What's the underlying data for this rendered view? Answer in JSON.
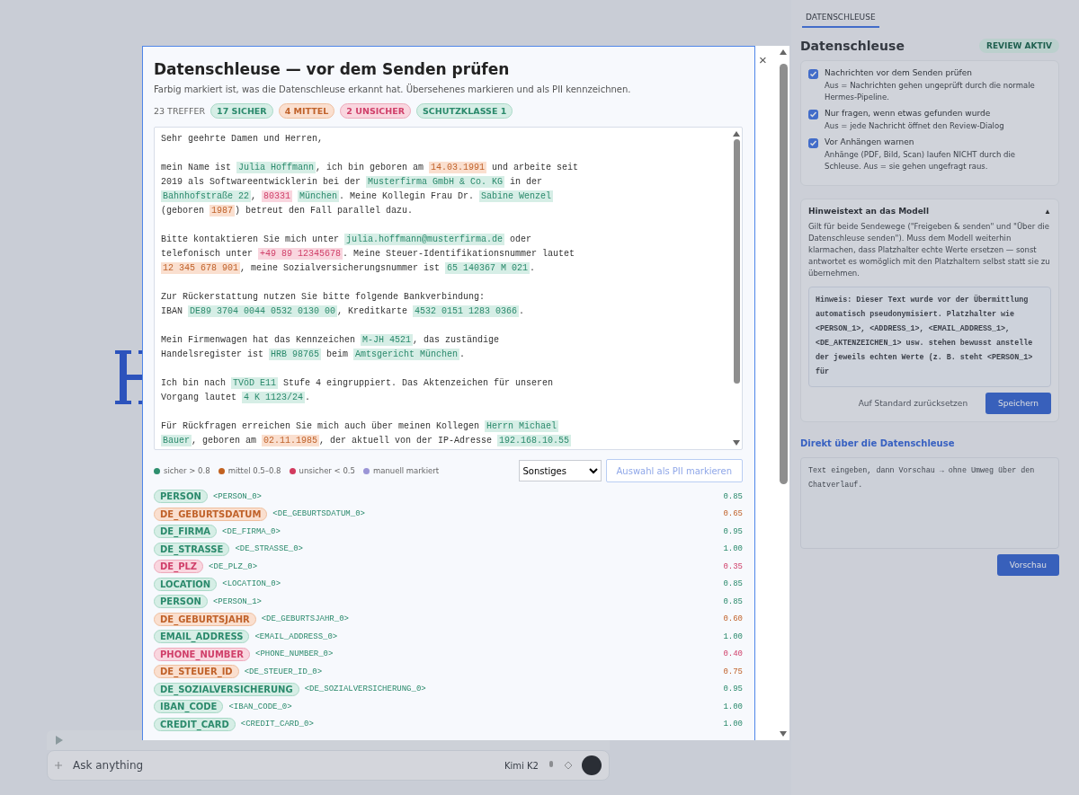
{
  "background": {
    "chat_placeholder": "Ask anything",
    "chat_model": "Kimi K2"
  },
  "side_panel": {
    "tab": {
      "label": "DATENSCHLEUSE",
      "selected": true
    },
    "title": "Datenschleuse",
    "status_badge": "REVIEW AKTIV",
    "options": [
      {
        "label": "Nachrichten vor dem Senden prüfen",
        "hint": "Aus = Nachrichten gehen ungeprüft durch die normale Hermes-Pipeline.",
        "checked": true
      },
      {
        "label": "Nur fragen, wenn etwas gefunden wurde",
        "hint": "Aus = jede Nachricht öffnet den Review-Dialog",
        "checked": true
      },
      {
        "label": "Vor Anhängen warnen",
        "hint": "Anhänge (PDF, Bild, Scan) laufen NICHT durch die Schleuse. Aus = sie gehen ungefragt raus.",
        "checked": true
      }
    ],
    "hint_section": {
      "title": "Hinweistext an das Modell",
      "toggle": "▲",
      "expanded": true,
      "description": "Gilt für beide Sendewege (\"Freigeben & senden\" und \"Über die Datenschleuse senden\"). Muss dem Modell weiterhin klarmachen, dass Platzhalter echte Werte ersetzen — sonst antwortet es womöglich mit den Platzhaltern selbst statt sie zu übernehmen.",
      "text": "Hinweis: Dieser Text wurde vor der Übermittlung automatisch pseudonymisiert. Platzhalter wie <PERSON_1>, <ADDRESS_1>, <EMAIL_ADDRESS_1>, <DE_AKTENZEICHEN_1> usw. stehen bewusst anstelle der jeweils echten Werte (z. B. steht <PERSON_1> für",
      "reset_button": "Auf Standard zurücksetzen",
      "save_button": "Speichern"
    },
    "direct": {
      "title": "Direkt über die Datenschleuse",
      "placeholder": "Text eingeben, dann Vorschau → ohne Umweg über den Chatverlauf.",
      "button": "Vorschau"
    }
  },
  "dialog": {
    "title": "Datenschleuse — vor dem Senden prüfen",
    "close": "×",
    "subtitle": "Farbig markiert ist, was die Datenschleuse erkannt hat. Übersehenes markieren und als PII kennzeichnen.",
    "total": "23 TREFFER",
    "badges": [
      {
        "label": "17 SICHER",
        "kind": "sicher"
      },
      {
        "label": "4 MITTEL",
        "kind": "mittel"
      },
      {
        "label": "2 UNSICHER",
        "kind": "unsicher"
      },
      {
        "label": "SCHUTZKLASSE 1",
        "kind": "sicher"
      }
    ],
    "paragraphs": [
      [
        [
          {
            "text": "Sehr geehrte Damen und Herren,",
            "kind": "plain"
          }
        ]
      ],
      [
        [
          {
            "text": "mein Name ist ",
            "kind": "plain"
          },
          {
            "text": "Julia Hoffmann",
            "kind": "sicher"
          },
          {
            "text": ", ich bin geboren am ",
            "kind": "plain"
          },
          {
            "text": "14.03.1991",
            "kind": "mittel"
          },
          {
            "text": " und arbeite seit",
            "kind": "plain"
          }
        ],
        [
          {
            "text": "2019 als Softwareentwicklerin bei der ",
            "kind": "plain"
          },
          {
            "text": "Musterfirma GmbH & Co. KG",
            "kind": "sicher"
          },
          {
            "text": " in der",
            "kind": "plain"
          }
        ],
        [
          {
            "text": "Bahnhofstraße 22",
            "kind": "sicher"
          },
          {
            "text": ", ",
            "kind": "plain"
          },
          {
            "text": "80331",
            "kind": "unsicher",
            "space_after": true
          },
          {
            "text": "München",
            "kind": "sicher"
          },
          {
            "text": ". Meine Kollegin Frau Dr. ",
            "kind": "plain"
          },
          {
            "text": "Sabine Wenzel",
            "kind": "sicher"
          }
        ],
        [
          {
            "text": "(geboren ",
            "kind": "plain"
          },
          {
            "text": "1987",
            "kind": "mittel"
          },
          {
            "text": ") betreut den Fall parallel dazu.",
            "kind": "plain"
          }
        ]
      ],
      [
        [
          {
            "text": "Bitte kontaktieren Sie mich unter ",
            "kind": "plain"
          },
          {
            "text": "julia.hoffmann@musterfirma.de",
            "kind": "sicher"
          },
          {
            "text": " oder",
            "kind": "plain"
          }
        ],
        [
          {
            "text": "telefonisch unter ",
            "kind": "plain"
          },
          {
            "text": "+49 89 12345678",
            "kind": "unsicher"
          },
          {
            "text": ". Meine Steuer-Identifikationsnummer lautet",
            "kind": "plain"
          }
        ],
        [
          {
            "text": "12 345 678 901",
            "kind": "mittel"
          },
          {
            "text": ", meine Sozialversicherungsnummer ist ",
            "kind": "plain"
          },
          {
            "text": "65 140367 M 021",
            "kind": "sicher"
          },
          {
            "text": ".",
            "kind": "plain"
          }
        ]
      ],
      [
        [
          {
            "text": "Zur Rückerstattung nutzen Sie bitte folgende Bankverbindung:",
            "kind": "plain"
          }
        ],
        [
          {
            "text": "IBAN ",
            "kind": "plain"
          },
          {
            "text": "DE89 3704 0044 0532 0130 00",
            "kind": "sicher"
          },
          {
            "text": ", Kreditkarte ",
            "kind": "plain"
          },
          {
            "text": "4532 0151 1283 0366",
            "kind": "sicher"
          },
          {
            "text": ".",
            "kind": "plain"
          }
        ]
      ],
      [
        [
          {
            "text": "Mein Firmenwagen hat das Kennzeichen ",
            "kind": "plain"
          },
          {
            "text": "M-JH 4521",
            "kind": "sicher"
          },
          {
            "text": ", das zuständige",
            "kind": "plain"
          }
        ],
        [
          {
            "text": "Handelsregister ist ",
            "kind": "plain"
          },
          {
            "text": "HRB 98765",
            "kind": "sicher"
          },
          {
            "text": " beim ",
            "kind": "plain"
          },
          {
            "text": "Amtsgericht München",
            "kind": "sicher"
          },
          {
            "text": ".",
            "kind": "plain"
          }
        ]
      ],
      [
        [
          {
            "text": "Ich bin nach ",
            "kind": "plain"
          },
          {
            "text": "TVöD E11",
            "kind": "sicher"
          },
          {
            "text": " Stufe 4 eingruppiert. Das Aktenzeichen für unseren",
            "kind": "plain"
          }
        ],
        [
          {
            "text": "Vorgang lautet ",
            "kind": "plain"
          },
          {
            "text": "4 K 1123/24",
            "kind": "sicher"
          },
          {
            "text": ".",
            "kind": "plain"
          }
        ]
      ],
      [
        [
          {
            "text": "Für Rückfragen erreichen Sie mich auch über meinen Kollegen ",
            "kind": "plain"
          },
          {
            "text": "Herrn Michael",
            "kind": "sicher"
          }
        ],
        [
          {
            "text": "Bauer",
            "kind": "sicher"
          },
          {
            "text": ", geboren am ",
            "kind": "plain"
          },
          {
            "text": "02.11.1985",
            "kind": "mittel"
          },
          {
            "text": ", der aktuell von der IP-Adresse ",
            "kind": "plain"
          },
          {
            "text": "192.168.10.55",
            "kind": "sicher"
          }
        ]
      ]
    ],
    "legend": [
      {
        "label": "sicher > 0.8",
        "color": "#2e8f6e"
      },
      {
        "label": "mittel 0.5–0.8",
        "color": "#c2611f"
      },
      {
        "label": "unsicher < 0.5",
        "color": "#d23a5e"
      },
      {
        "label": "manuell markiert",
        "color": "#9b95d6"
      }
    ],
    "category_select": "Sonstiges",
    "mark_button": "Auswahl als PII markieren",
    "entities": [
      {
        "type": "PERSON",
        "placeholder": "<PERSON_0>",
        "score": "0.85",
        "kind": "sicher"
      },
      {
        "type": "DE_GEBURTSDATUM",
        "placeholder": "<DE_GEBURTSDATUM_0>",
        "score": "0.65",
        "kind": "mittel"
      },
      {
        "type": "DE_FIRMA",
        "placeholder": "<DE_FIRMA_0>",
        "score": "0.95",
        "kind": "sicher"
      },
      {
        "type": "DE_STRASSE",
        "placeholder": "<DE_STRASSE_0>",
        "score": "1.00",
        "kind": "sicher"
      },
      {
        "type": "DE_PLZ",
        "placeholder": "<DE_PLZ_0>",
        "score": "0.35",
        "kind": "unsicher"
      },
      {
        "type": "LOCATION",
        "placeholder": "<LOCATION_0>",
        "score": "0.85",
        "kind": "sicher"
      },
      {
        "type": "PERSON",
        "placeholder": "<PERSON_1>",
        "score": "0.85",
        "kind": "sicher"
      },
      {
        "type": "DE_GEBURTSJAHR",
        "placeholder": "<DE_GEBURTSJAHR_0>",
        "score": "0.60",
        "kind": "mittel"
      },
      {
        "type": "EMAIL_ADDRESS",
        "placeholder": "<EMAIL_ADDRESS_0>",
        "score": "1.00",
        "kind": "sicher"
      },
      {
        "type": "PHONE_NUMBER",
        "placeholder": "<PHONE_NUMBER_0>",
        "score": "0.40",
        "kind": "unsicher"
      },
      {
        "type": "DE_STEUER_ID",
        "placeholder": "<DE_STEUER_ID_0>",
        "score": "0.75",
        "kind": "mittel"
      },
      {
        "type": "DE_SOZIALVERSICHERUNG",
        "placeholder": "<DE_SOZIALVERSICHERUNG_0>",
        "score": "0.95",
        "kind": "sicher"
      },
      {
        "type": "IBAN_CODE",
        "placeholder": "<IBAN_CODE_0>",
        "score": "1.00",
        "kind": "sicher"
      },
      {
        "type": "CREDIT_CARD",
        "placeholder": "<CREDIT_CARD_0>",
        "score": "1.00",
        "kind": "sicher"
      }
    ]
  }
}
